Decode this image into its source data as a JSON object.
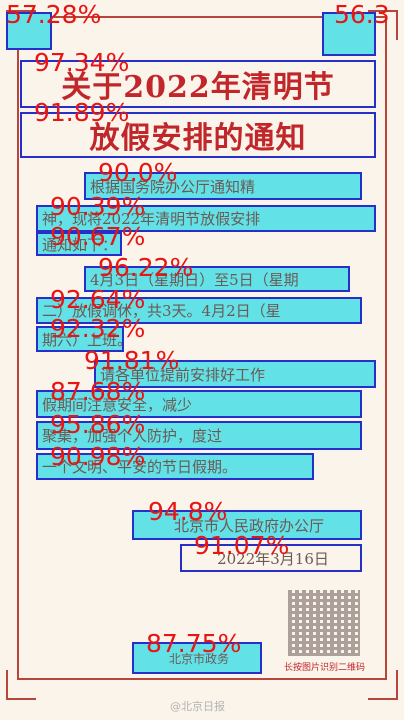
{
  "labels": {
    "top_left": "57.28%",
    "top_right": "56.3",
    "title1": "97.34%",
    "title2": "91.89%",
    "line1": "90.0%",
    "line2": "90.39%",
    "line3": "90.67%",
    "line4": "96.22%",
    "line5": "92.64%",
    "line6": "92.32%",
    "line7": "91.81%",
    "line8": "87.68%",
    "line9": "95.86%",
    "line10": "90.98%",
    "sig1": "94.8%",
    "sig2": "91.07%",
    "footer": "87.75%"
  },
  "document": {
    "title_line1": "关于2022年清明节",
    "title_line2": "放假安排的通知",
    "lines": [
      "根据国务院办公厅通知精",
      "神，现将2022年清明节放假安排",
      "通知如下：",
      "4月3日（星期日）至5日（星期",
      "二）放假调休，共3天。4月2日（星",
      "期六）上班。",
      "请各单位提前安排好工作",
      "假期间注意安全，减少",
      "聚集，加强个人防护，度过",
      "一个文明、平安的节日假期。"
    ],
    "signature": "北京市人民政府办公厅",
    "date": "2022年3月16日",
    "qr_caption": "长按图片识别二维码",
    "footer_text": "北京市政务",
    "watermark": "@北京日报"
  }
}
